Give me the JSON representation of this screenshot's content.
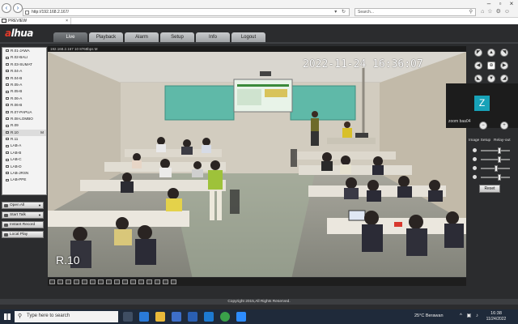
{
  "browser": {
    "url": "http://192.168.2.167/",
    "search_placeholder": "Search...",
    "tab_title": "PREVIEW"
  },
  "app": {
    "logo_prefix": "a",
    "logo_main": "lhua",
    "nav": [
      "Live",
      "Playback",
      "Alarm",
      "Setup",
      "Info",
      "Logout"
    ],
    "active_nav": "Live",
    "devices": [
      "R.01-JAWA",
      "R.02-BALI",
      "R.03-SUMAT",
      "R.04-A",
      "R.04-B",
      "R.05-A",
      "R.05-B",
      "R.06-A",
      "R.06-B",
      "R.07-PAPUA",
      "R.08-LOMBO",
      "R.09",
      "R.10",
      "R.11",
      "LAB-A",
      "LAB-B",
      "LAB-C",
      "LAB-D",
      "LAB-JRSN",
      "LAB-PPE"
    ],
    "selected_device": "R.10",
    "selected_mark": "M",
    "controls": [
      "Open All",
      "Start Talk",
      "Instant Record",
      "Local Play"
    ],
    "video_info": "192.168.2.167 10 8768bps M",
    "timestamp": "2022-11-24 16:36:07",
    "camera_name": "R.10",
    "image_setup": "Image Setup",
    "relay_out": "Relay-out",
    "image_levels": [
      0.62,
      0.62,
      0.5,
      0.62
    ],
    "reset_label": "Reset",
    "footer": "Copyright 2015,All Rights Reserved."
  },
  "zoom": {
    "initial": "Z",
    "name": "zoom baa04",
    "avatar_color": "#17a2b8"
  },
  "taskbar": {
    "search_placeholder": "Type here to search",
    "weather": "25°C Berawan",
    "time": "16:38",
    "date": "11/24/2022"
  }
}
